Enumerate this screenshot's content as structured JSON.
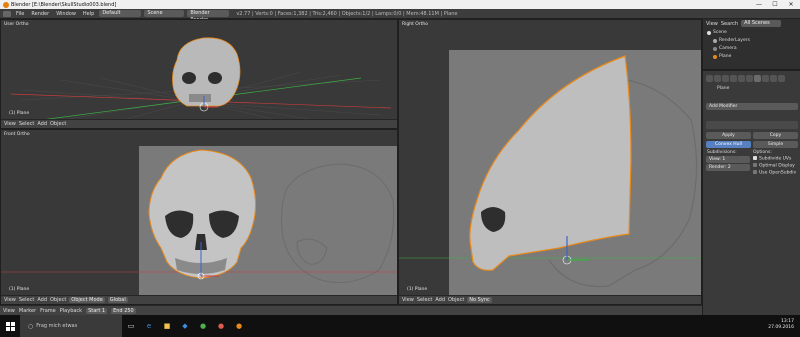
{
  "window": {
    "title": "Blender [E:\\Blender\\SkullStudio003.blend]",
    "minimize": "—",
    "maximize": "☐",
    "close": "✕"
  },
  "info_header": {
    "menus": [
      "File",
      "Render",
      "Window",
      "Help"
    ],
    "layout": "Default",
    "scene": "Scene",
    "engine": "Blender Render",
    "stats": "v2.77 | Verts:0 | Faces:1,382 | Tris:2,460 | Objects:1/2 | Lamps:0/0 | Mem:48.11M | Plane"
  },
  "views": {
    "user_ortho": {
      "label": "User Ortho",
      "object": "(1) Plane"
    },
    "front_ortho": {
      "label": "Front Ortho",
      "object": "(1) Plane"
    },
    "right_ortho": {
      "label": "Right Ortho",
      "object": "(1) Plane"
    }
  },
  "view_header": {
    "menus": [
      "View",
      "Select",
      "Add",
      "Object"
    ],
    "mode": "Object Mode",
    "pivot": "Global",
    "sync": "No Sync",
    "menus_bottom": [
      "View",
      "Marker",
      "Frame",
      "Playback"
    ],
    "start": "Start",
    "start_val": "1",
    "end": "End",
    "end_val": "250"
  },
  "outliner": {
    "view_label": "View",
    "search_label": "Search",
    "scenes": "All Scenes",
    "items": [
      "Scene",
      "RenderLayers",
      "Camera",
      "Plane"
    ]
  },
  "properties": {
    "object_name": "Plane",
    "add_modifier": "Add Modifier",
    "apply": "Apply",
    "copy": "Copy",
    "convex_hull": "Convex Hull",
    "simple": "Simple",
    "subdivisions_label": "Subdivisions:",
    "options_label": "Options:",
    "view_field": "View: 1",
    "render_field": "Render: 2",
    "option1": "Subdivide UVs",
    "option2": "Optimal Display",
    "option3": "Use OpenSubdiv"
  },
  "taskbar": {
    "search_placeholder": "Frag mich etwas",
    "time": "13:17",
    "date": "27.09.2016"
  },
  "colors": {
    "accent_orange": "#e8891b",
    "axis_red": "#c83c3c",
    "axis_green": "#3cb043",
    "blue_button": "#5680c2"
  }
}
